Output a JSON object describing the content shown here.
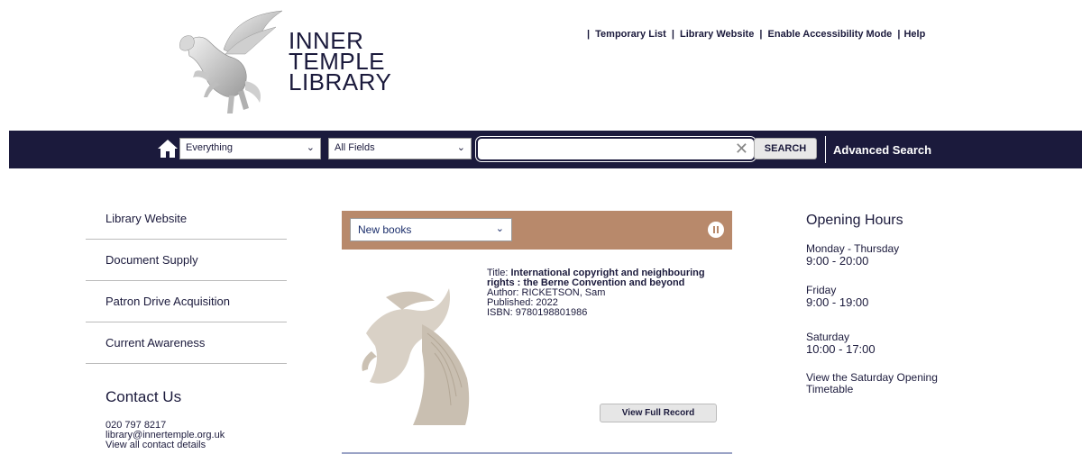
{
  "logo": {
    "line1": "INNER",
    "line2": "TEMPLE",
    "line3": "LIBRARY"
  },
  "toplinks": {
    "sep": "|",
    "temporary_list": "Temporary List",
    "library_website": "Library Website",
    "accessibility": "Enable Accessibility Mode",
    "help": "Help"
  },
  "search": {
    "scope_value": "Everything",
    "field_value": "All Fields",
    "query_value": "",
    "clear_glyph": "✕",
    "button_label": "SEARCH",
    "advanced_label": "Advanced Search"
  },
  "sidebar": {
    "items": [
      {
        "label": "Library Website"
      },
      {
        "label": "Document Supply"
      },
      {
        "label": "Patron Drive Acquisition"
      },
      {
        "label": "Current Awareness"
      }
    ],
    "contact_title": "Contact Us",
    "contact_phone": "020 797 8217",
    "contact_email": "library@innertemple.org.uk",
    "contact_link": "View all contact details"
  },
  "carousel": {
    "select_value": "New books",
    "book": {
      "title_prefix": "Title:",
      "title": "International copyright and neighbouring rights : the Berne Convention and beyond",
      "author": "Author: RICKETSON, Sam",
      "published": "Published: 2022",
      "isbn": "ISBN: 9780198801986"
    },
    "view_button": "View Full Record"
  },
  "hours": {
    "title": "Opening Hours",
    "mon_thu_label": "Monday - Thursday",
    "mon_thu_time": "9:00 - 20:00",
    "fri_label": "Friday",
    "fri_time": "9:00 - 19:00",
    "sat_label": "Saturday",
    "sat_time": "10:00 - 17:00",
    "sat_link": "View the Saturday Opening Timetable"
  },
  "colors": {
    "navy": "#1b1a3c",
    "accent_brown": "#b8896b"
  },
  "icons": [
    "home-icon",
    "chevron-down-icon",
    "clear-icon",
    "pause-icon",
    "pegasus-logo-icon"
  ]
}
